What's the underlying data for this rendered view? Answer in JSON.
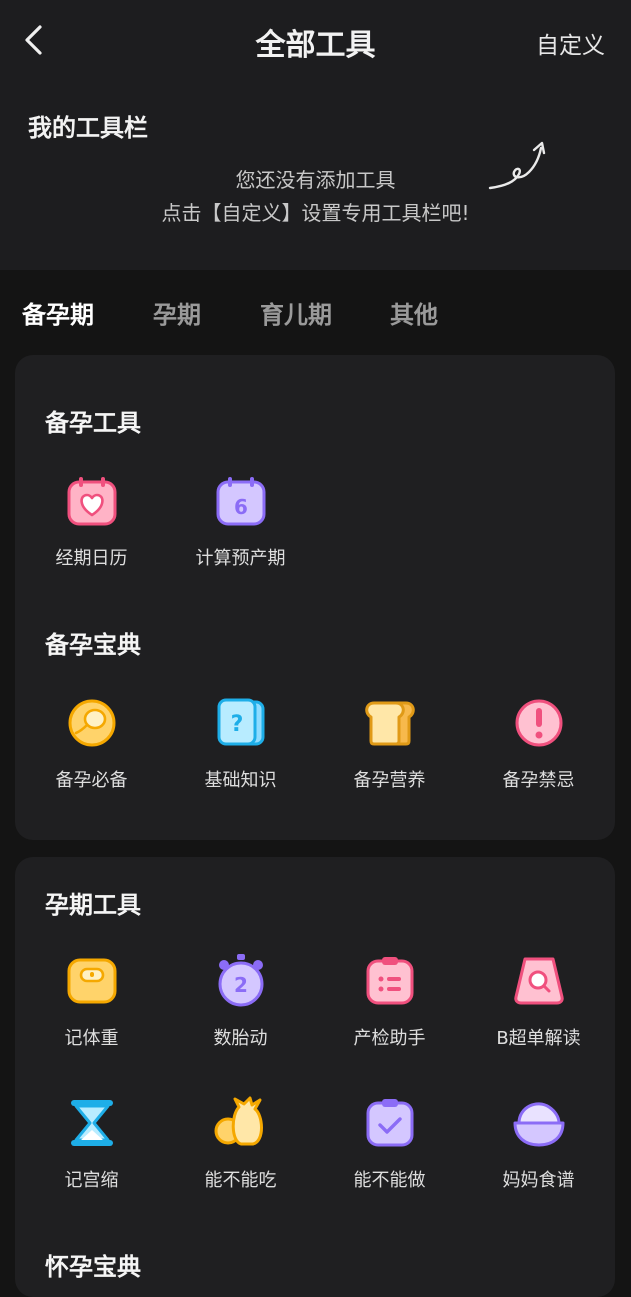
{
  "header": {
    "title": "全部工具",
    "customize": "自定义"
  },
  "my_toolbar": {
    "title": "我的工具栏",
    "empty_line1": "您还没有添加工具",
    "empty_line2": "点击【自定义】设置专用工具栏吧!"
  },
  "tabs": [
    {
      "label": "备孕期",
      "active": true
    },
    {
      "label": "孕期"
    },
    {
      "label": "育儿期"
    },
    {
      "label": "其他"
    }
  ],
  "sections": {
    "prep_tools": {
      "title": "备孕工具",
      "items": [
        {
          "label": "经期日历",
          "icon": "calendar-heart-icon"
        },
        {
          "label": "计算预产期",
          "icon": "calendar-six-icon"
        }
      ]
    },
    "prep_guide": {
      "title": "备孕宝典",
      "items": [
        {
          "label": "备孕必备",
          "icon": "egg-icon"
        },
        {
          "label": "基础知识",
          "icon": "question-book-icon"
        },
        {
          "label": "备孕营养",
          "icon": "bread-icon"
        },
        {
          "label": "备孕禁忌",
          "icon": "exclamation-icon"
        }
      ]
    },
    "preg_tools": {
      "title": "孕期工具",
      "items": [
        {
          "label": "记体重",
          "icon": "scale-icon"
        },
        {
          "label": "数胎动",
          "icon": "stopwatch-icon"
        },
        {
          "label": "产检助手",
          "icon": "checklist-icon"
        },
        {
          "label": "B超单解读",
          "icon": "ultrasound-icon"
        },
        {
          "label": "记宫缩",
          "icon": "hourglass-icon"
        },
        {
          "label": "能不能吃",
          "icon": "food-bag-icon"
        },
        {
          "label": "能不能做",
          "icon": "clipboard-check-icon"
        },
        {
          "label": "妈妈食谱",
          "icon": "bowl-icon"
        }
      ]
    },
    "preg_guide": {
      "title": "怀孕宝典"
    }
  },
  "colors": {
    "pink": "#ff6f96",
    "purple": "#9a7dff",
    "orange": "#ffc437",
    "blue": "#37c7ff"
  }
}
